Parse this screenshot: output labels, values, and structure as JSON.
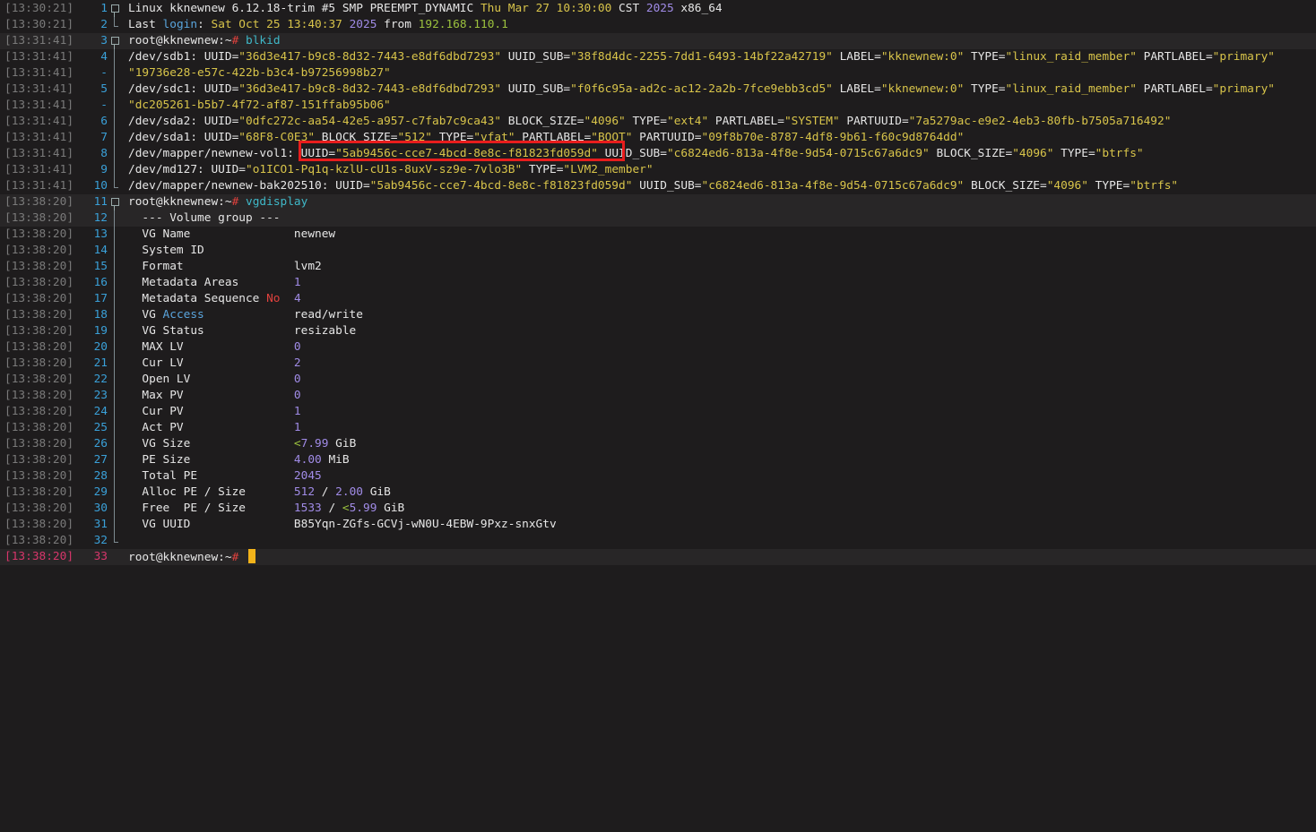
{
  "lines": [
    {
      "ts": "[13:30:21]",
      "n": "1",
      "fold": "box",
      "segs": [
        [
          "Linux kknewnew 6.12.18-trim #5 SMP PREEMPT_DYNAMIC ",
          "w"
        ],
        [
          "Thu Mar 27 10:30:00",
          "y"
        ],
        [
          " CST ",
          "w"
        ],
        [
          "2025",
          "p"
        ],
        [
          " x86_64",
          "w"
        ]
      ]
    },
    {
      "ts": "[13:30:21]",
      "n": "2",
      "fold": "end",
      "segs": [
        [
          "Last ",
          "w"
        ],
        [
          "login",
          "c"
        ],
        [
          ": ",
          "w"
        ],
        [
          "Sat Oct 25 13:40:37",
          "y"
        ],
        [
          " ",
          "w"
        ],
        [
          "2025",
          "p"
        ],
        [
          " from ",
          "w"
        ],
        [
          "192.168.110.1",
          "g"
        ]
      ]
    },
    {
      "ts": "[13:31:41]",
      "n": "3",
      "fold": "box",
      "band": true,
      "segs": [
        [
          "root@kknewnew:~",
          "w"
        ],
        [
          "# ",
          "red"
        ],
        [
          "blkid",
          "cyan"
        ]
      ]
    },
    {
      "ts": "[13:31:41]",
      "n": "4",
      "fold": "bar",
      "segs": [
        [
          "/dev/sdb1: UUID=",
          "w"
        ],
        [
          "\"36d3e417-b9c8-8d32-7443-e8df6dbd7293\"",
          "y"
        ],
        [
          " UUID_SUB=",
          "w"
        ],
        [
          "\"38f8d4dc-2255-7dd1-6493-14bf22a42719\"",
          "y"
        ],
        [
          " LABEL=",
          "w"
        ],
        [
          "\"kknewnew:0\"",
          "y"
        ],
        [
          " TYPE=",
          "w"
        ],
        [
          "\"linux_raid_member\"",
          "y"
        ],
        [
          " PARTLABEL=",
          "w"
        ],
        [
          "\"primary\"",
          "y"
        ]
      ]
    },
    {
      "ts": "[13:31:41]",
      "n": "-",
      "fold": "bar",
      "segs": [
        [
          "\"19736e28-e57c-422b-b3c4-b97256998b27\"",
          "y"
        ]
      ]
    },
    {
      "ts": "[13:31:41]",
      "n": "5",
      "fold": "bar",
      "segs": [
        [
          "/dev/sdc1: UUID=",
          "w"
        ],
        [
          "\"36d3e417-b9c8-8d32-7443-e8df6dbd7293\"",
          "y"
        ],
        [
          " UUID_SUB=",
          "w"
        ],
        [
          "\"f0f6c95a-ad2c-ac12-2a2b-7fce9ebb3cd5\"",
          "y"
        ],
        [
          " LABEL=",
          "w"
        ],
        [
          "\"kknewnew:0\"",
          "y"
        ],
        [
          " TYPE=",
          "w"
        ],
        [
          "\"linux_raid_member\"",
          "y"
        ],
        [
          " PARTLABEL=",
          "w"
        ],
        [
          "\"primary\"",
          "y"
        ]
      ]
    },
    {
      "ts": "[13:31:41]",
      "n": "-",
      "fold": "bar",
      "segs": [
        [
          "\"dc205261-b5b7-4f72-af87-151ffab95b06\"",
          "y"
        ]
      ]
    },
    {
      "ts": "[13:31:41]",
      "n": "6",
      "fold": "bar",
      "segs": [
        [
          "/dev/sda2: UUID=",
          "w"
        ],
        [
          "\"0dfc272c-aa54-42e5-a957-c7fab7c9ca43\"",
          "y"
        ],
        [
          " BLOCK_SIZE=",
          "w"
        ],
        [
          "\"4096\"",
          "y"
        ],
        [
          " TYPE=",
          "w"
        ],
        [
          "\"ext4\"",
          "y"
        ],
        [
          " PARTLABEL=",
          "w"
        ],
        [
          "\"SYSTEM\"",
          "y"
        ],
        [
          " PARTUUID=",
          "w"
        ],
        [
          "\"7a5279ac-e9e2-4eb3-80fb-b7505a716492\"",
          "y"
        ]
      ]
    },
    {
      "ts": "[13:31:41]",
      "n": "7",
      "fold": "bar",
      "segs": [
        [
          "/dev/sda1: UUID=",
          "w"
        ],
        [
          "\"68F8-C0E3\"",
          "y"
        ],
        [
          " BLOCK_SIZE=",
          "w"
        ],
        [
          "\"512\"",
          "y"
        ],
        [
          " TYPE=",
          "w"
        ],
        [
          "\"vfat\"",
          "y"
        ],
        [
          " PARTLABEL=",
          "w"
        ],
        [
          "\"BOOT\"",
          "y"
        ],
        [
          " PARTUUID=",
          "w"
        ],
        [
          "\"09f8b70e-8787-4df8-9b61-f60c9d8764dd\"",
          "y"
        ]
      ]
    },
    {
      "ts": "[13:31:41]",
      "n": "8",
      "fold": "bar",
      "segs": [
        [
          "/dev/mapper/newnew-vol1: UUID=",
          "w"
        ],
        [
          "\"5ab9456c-cce7-4bcd-8e8c-f81823fd059d\"",
          "y"
        ],
        [
          " UUID_SUB=",
          "w"
        ],
        [
          "\"c6824ed6-813a-4f8e-9d54-0715c67a6dc9\"",
          "y"
        ],
        [
          " BLOCK_SIZE=",
          "w"
        ],
        [
          "\"4096\"",
          "y"
        ],
        [
          " TYPE=",
          "w"
        ],
        [
          "\"btrfs\"",
          "y"
        ]
      ]
    },
    {
      "ts": "[13:31:41]",
      "n": "9",
      "fold": "bar",
      "segs": [
        [
          "/dev/md127: UUID=",
          "w"
        ],
        [
          "\"o1ICO1-Pq1q-kzlU-cU1s-8uxV-sz9e-7vlo3B\"",
          "y"
        ],
        [
          " TYPE=",
          "w"
        ],
        [
          "\"LVM2_member\"",
          "y"
        ]
      ]
    },
    {
      "ts": "[13:31:41]",
      "n": "10",
      "fold": "end",
      "segs": [
        [
          "/dev/mapper/newnew-bak202510: UUID=",
          "w"
        ],
        [
          "\"5ab9456c-cce7-4bcd-8e8c-f81823fd059d\"",
          "y"
        ],
        [
          " UUID_SUB=",
          "w"
        ],
        [
          "\"c6824ed6-813a-4f8e-9d54-0715c67a6dc9\"",
          "y"
        ],
        [
          " BLOCK_SIZE=",
          "w"
        ],
        [
          "\"4096\"",
          "y"
        ],
        [
          " TYPE=",
          "w"
        ],
        [
          "\"btrfs\"",
          "y"
        ]
      ]
    },
    {
      "ts": "[13:38:20]",
      "n": "11",
      "fold": "box",
      "band": true,
      "segs": [
        [
          "root@kknewnew:~",
          "w"
        ],
        [
          "# ",
          "red"
        ],
        [
          "vgdisplay",
          "cyan"
        ]
      ]
    },
    {
      "ts": "[13:38:20]",
      "n": "12",
      "fold": "bar",
      "band": true,
      "segs": [
        [
          "  --- Volume group ---",
          "w"
        ]
      ]
    },
    {
      "ts": "[13:38:20]",
      "n": "13",
      "fold": "bar",
      "segs": [
        [
          "  VG Name               newnew",
          "w"
        ]
      ]
    },
    {
      "ts": "[13:38:20]",
      "n": "14",
      "fold": "bar",
      "segs": [
        [
          "  System ID",
          "w"
        ]
      ]
    },
    {
      "ts": "[13:38:20]",
      "n": "15",
      "fold": "bar",
      "segs": [
        [
          "  Format                lvm2",
          "w"
        ]
      ]
    },
    {
      "ts": "[13:38:20]",
      "n": "16",
      "fold": "bar",
      "segs": [
        [
          "  Metadata Areas        ",
          "w"
        ],
        [
          "1",
          "p"
        ]
      ]
    },
    {
      "ts": "[13:38:20]",
      "n": "17",
      "fold": "bar",
      "segs": [
        [
          "  Metadata Sequence ",
          "w"
        ],
        [
          "No",
          "r"
        ],
        [
          "  ",
          "w"
        ],
        [
          "4",
          "p"
        ]
      ]
    },
    {
      "ts": "[13:38:20]",
      "n": "18",
      "fold": "bar",
      "segs": [
        [
          "  VG ",
          "w"
        ],
        [
          "Access",
          "c"
        ],
        [
          "             read/write",
          "w"
        ]
      ]
    },
    {
      "ts": "[13:38:20]",
      "n": "19",
      "fold": "bar",
      "segs": [
        [
          "  VG Status             resizable",
          "w"
        ]
      ]
    },
    {
      "ts": "[13:38:20]",
      "n": "20",
      "fold": "bar",
      "segs": [
        [
          "  MAX LV                ",
          "w"
        ],
        [
          "0",
          "p"
        ]
      ]
    },
    {
      "ts": "[13:38:20]",
      "n": "21",
      "fold": "bar",
      "segs": [
        [
          "  Cur LV                ",
          "w"
        ],
        [
          "2",
          "p"
        ]
      ]
    },
    {
      "ts": "[13:38:20]",
      "n": "22",
      "fold": "bar",
      "segs": [
        [
          "  Open LV               ",
          "w"
        ],
        [
          "0",
          "p"
        ]
      ]
    },
    {
      "ts": "[13:38:20]",
      "n": "23",
      "fold": "bar",
      "segs": [
        [
          "  Max PV                ",
          "w"
        ],
        [
          "0",
          "p"
        ]
      ]
    },
    {
      "ts": "[13:38:20]",
      "n": "24",
      "fold": "bar",
      "segs": [
        [
          "  Cur PV                ",
          "w"
        ],
        [
          "1",
          "p"
        ]
      ]
    },
    {
      "ts": "[13:38:20]",
      "n": "25",
      "fold": "bar",
      "segs": [
        [
          "  Act PV                ",
          "w"
        ],
        [
          "1",
          "p"
        ]
      ]
    },
    {
      "ts": "[13:38:20]",
      "n": "26",
      "fold": "bar",
      "segs": [
        [
          "  VG Size               ",
          "w"
        ],
        [
          "<",
          "g"
        ],
        [
          "7.99",
          "p"
        ],
        [
          " GiB",
          "w"
        ]
      ]
    },
    {
      "ts": "[13:38:20]",
      "n": "27",
      "fold": "bar",
      "segs": [
        [
          "  PE Size               ",
          "w"
        ],
        [
          "4.00",
          "p"
        ],
        [
          " MiB",
          "w"
        ]
      ]
    },
    {
      "ts": "[13:38:20]",
      "n": "28",
      "fold": "bar",
      "segs": [
        [
          "  Total PE              ",
          "w"
        ],
        [
          "2045",
          "p"
        ]
      ]
    },
    {
      "ts": "[13:38:20]",
      "n": "29",
      "fold": "bar",
      "segs": [
        [
          "  Alloc PE / Size       ",
          "w"
        ],
        [
          "512",
          "p"
        ],
        [
          " / ",
          "w"
        ],
        [
          "2.00",
          "p"
        ],
        [
          " GiB",
          "w"
        ]
      ]
    },
    {
      "ts": "[13:38:20]",
      "n": "30",
      "fold": "bar",
      "segs": [
        [
          "  Free  PE / Size       ",
          "w"
        ],
        [
          "1533",
          "p"
        ],
        [
          " / ",
          "w"
        ],
        [
          "<",
          "g"
        ],
        [
          "5.99",
          "p"
        ],
        [
          " GiB",
          "w"
        ]
      ]
    },
    {
      "ts": "[13:38:20]",
      "n": "31",
      "fold": "bar",
      "segs": [
        [
          "  VG UUID               B85Yqn-ZGfs-GCVj-wN0U-4EBW-9Pxz-snxGtv",
          "w"
        ]
      ]
    },
    {
      "ts": "[13:38:20]",
      "n": "32",
      "fold": "end",
      "segs": [
        [
          "",
          "w"
        ]
      ]
    },
    {
      "ts": "[13:38:20]",
      "n": "33",
      "fold": "none",
      "cur": true,
      "band": true,
      "segs": [
        [
          "root@kknewnew:~",
          "w"
        ],
        [
          "# ",
          "red"
        ]
      ]
    }
  ],
  "colors": {
    "background": "#1e1c1d",
    "highlight": "#e81d1d",
    "cursor": "#f2b31a"
  }
}
